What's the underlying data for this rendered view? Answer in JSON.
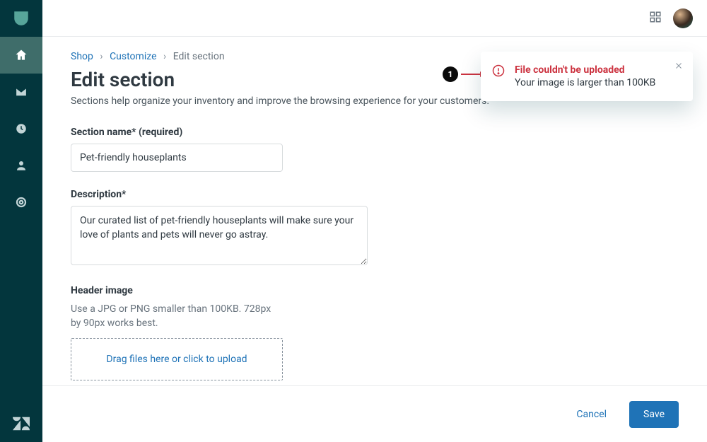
{
  "breadcrumb": {
    "shop": "Shop",
    "customize": "Customize",
    "current": "Edit section"
  },
  "page": {
    "title": "Edit section",
    "subtitle": "Sections help organize your inventory and improve the browsing experience for your customers."
  },
  "form": {
    "sectionName": {
      "label": "Section name* (required)",
      "value": "Pet-friendly houseplants"
    },
    "description": {
      "label": "Description*",
      "value": "Our curated list of pet-friendly houseplants will make sure your love of plants and pets will never go astray."
    },
    "headerImage": {
      "label": "Header image",
      "help": "Use a JPG or PNG smaller than 100KB. 728px by 90px works best.",
      "dropzone": "Drag files here or click to upload"
    }
  },
  "footer": {
    "cancel": "Cancel",
    "save": "Save"
  },
  "toast": {
    "title": "File couldn't be uploaded",
    "body": "Your image is larger than 100KB"
  },
  "callout": {
    "number": "1"
  }
}
